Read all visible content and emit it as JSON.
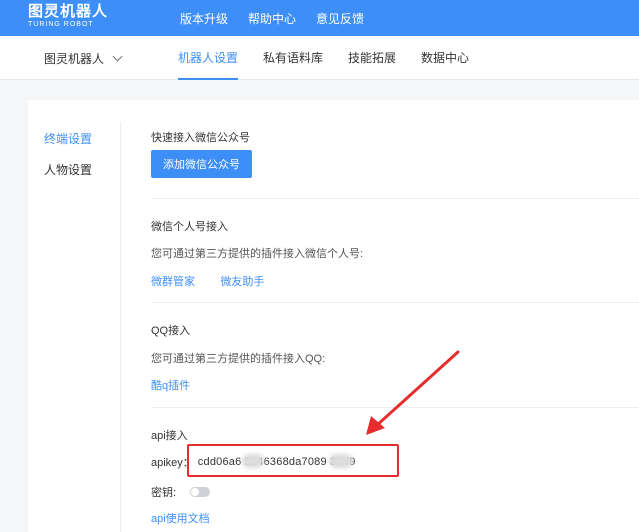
{
  "header": {
    "logo_cn": "图灵机器人",
    "logo_en": "TURING ROBOT",
    "nav": [
      "版本升级",
      "帮助中心",
      "意见反馈"
    ]
  },
  "subnav": {
    "robot_name": "图灵机器人",
    "tabs": [
      "机器人设置",
      "私有语料库",
      "技能拓展",
      "数据中心"
    ]
  },
  "sidebar": {
    "items": [
      "终端设置",
      "人物设置"
    ]
  },
  "wechat_official": {
    "title": "快速接入微信公众号",
    "button": "添加微信公众号"
  },
  "wechat_personal": {
    "title": "微信个人号接入",
    "desc": "您可通过第三方提供的插件接入微信个人号:",
    "links": [
      "微群管家",
      "微友助手"
    ]
  },
  "qq": {
    "title": "QQ接入",
    "desc": "您可通过第三方提供的插件接入QQ:",
    "link": "酷q插件"
  },
  "api": {
    "title": "api接入",
    "apikey_label": "apikey：",
    "apikey_value": "cdd06a6  5546368da7089  3f6f9",
    "secret_label": "密钥:",
    "secret_enabled": false,
    "docs_link": "api使用文档"
  },
  "colors": {
    "brand": "#3d8ff7",
    "highlight": "#e52d2d"
  }
}
